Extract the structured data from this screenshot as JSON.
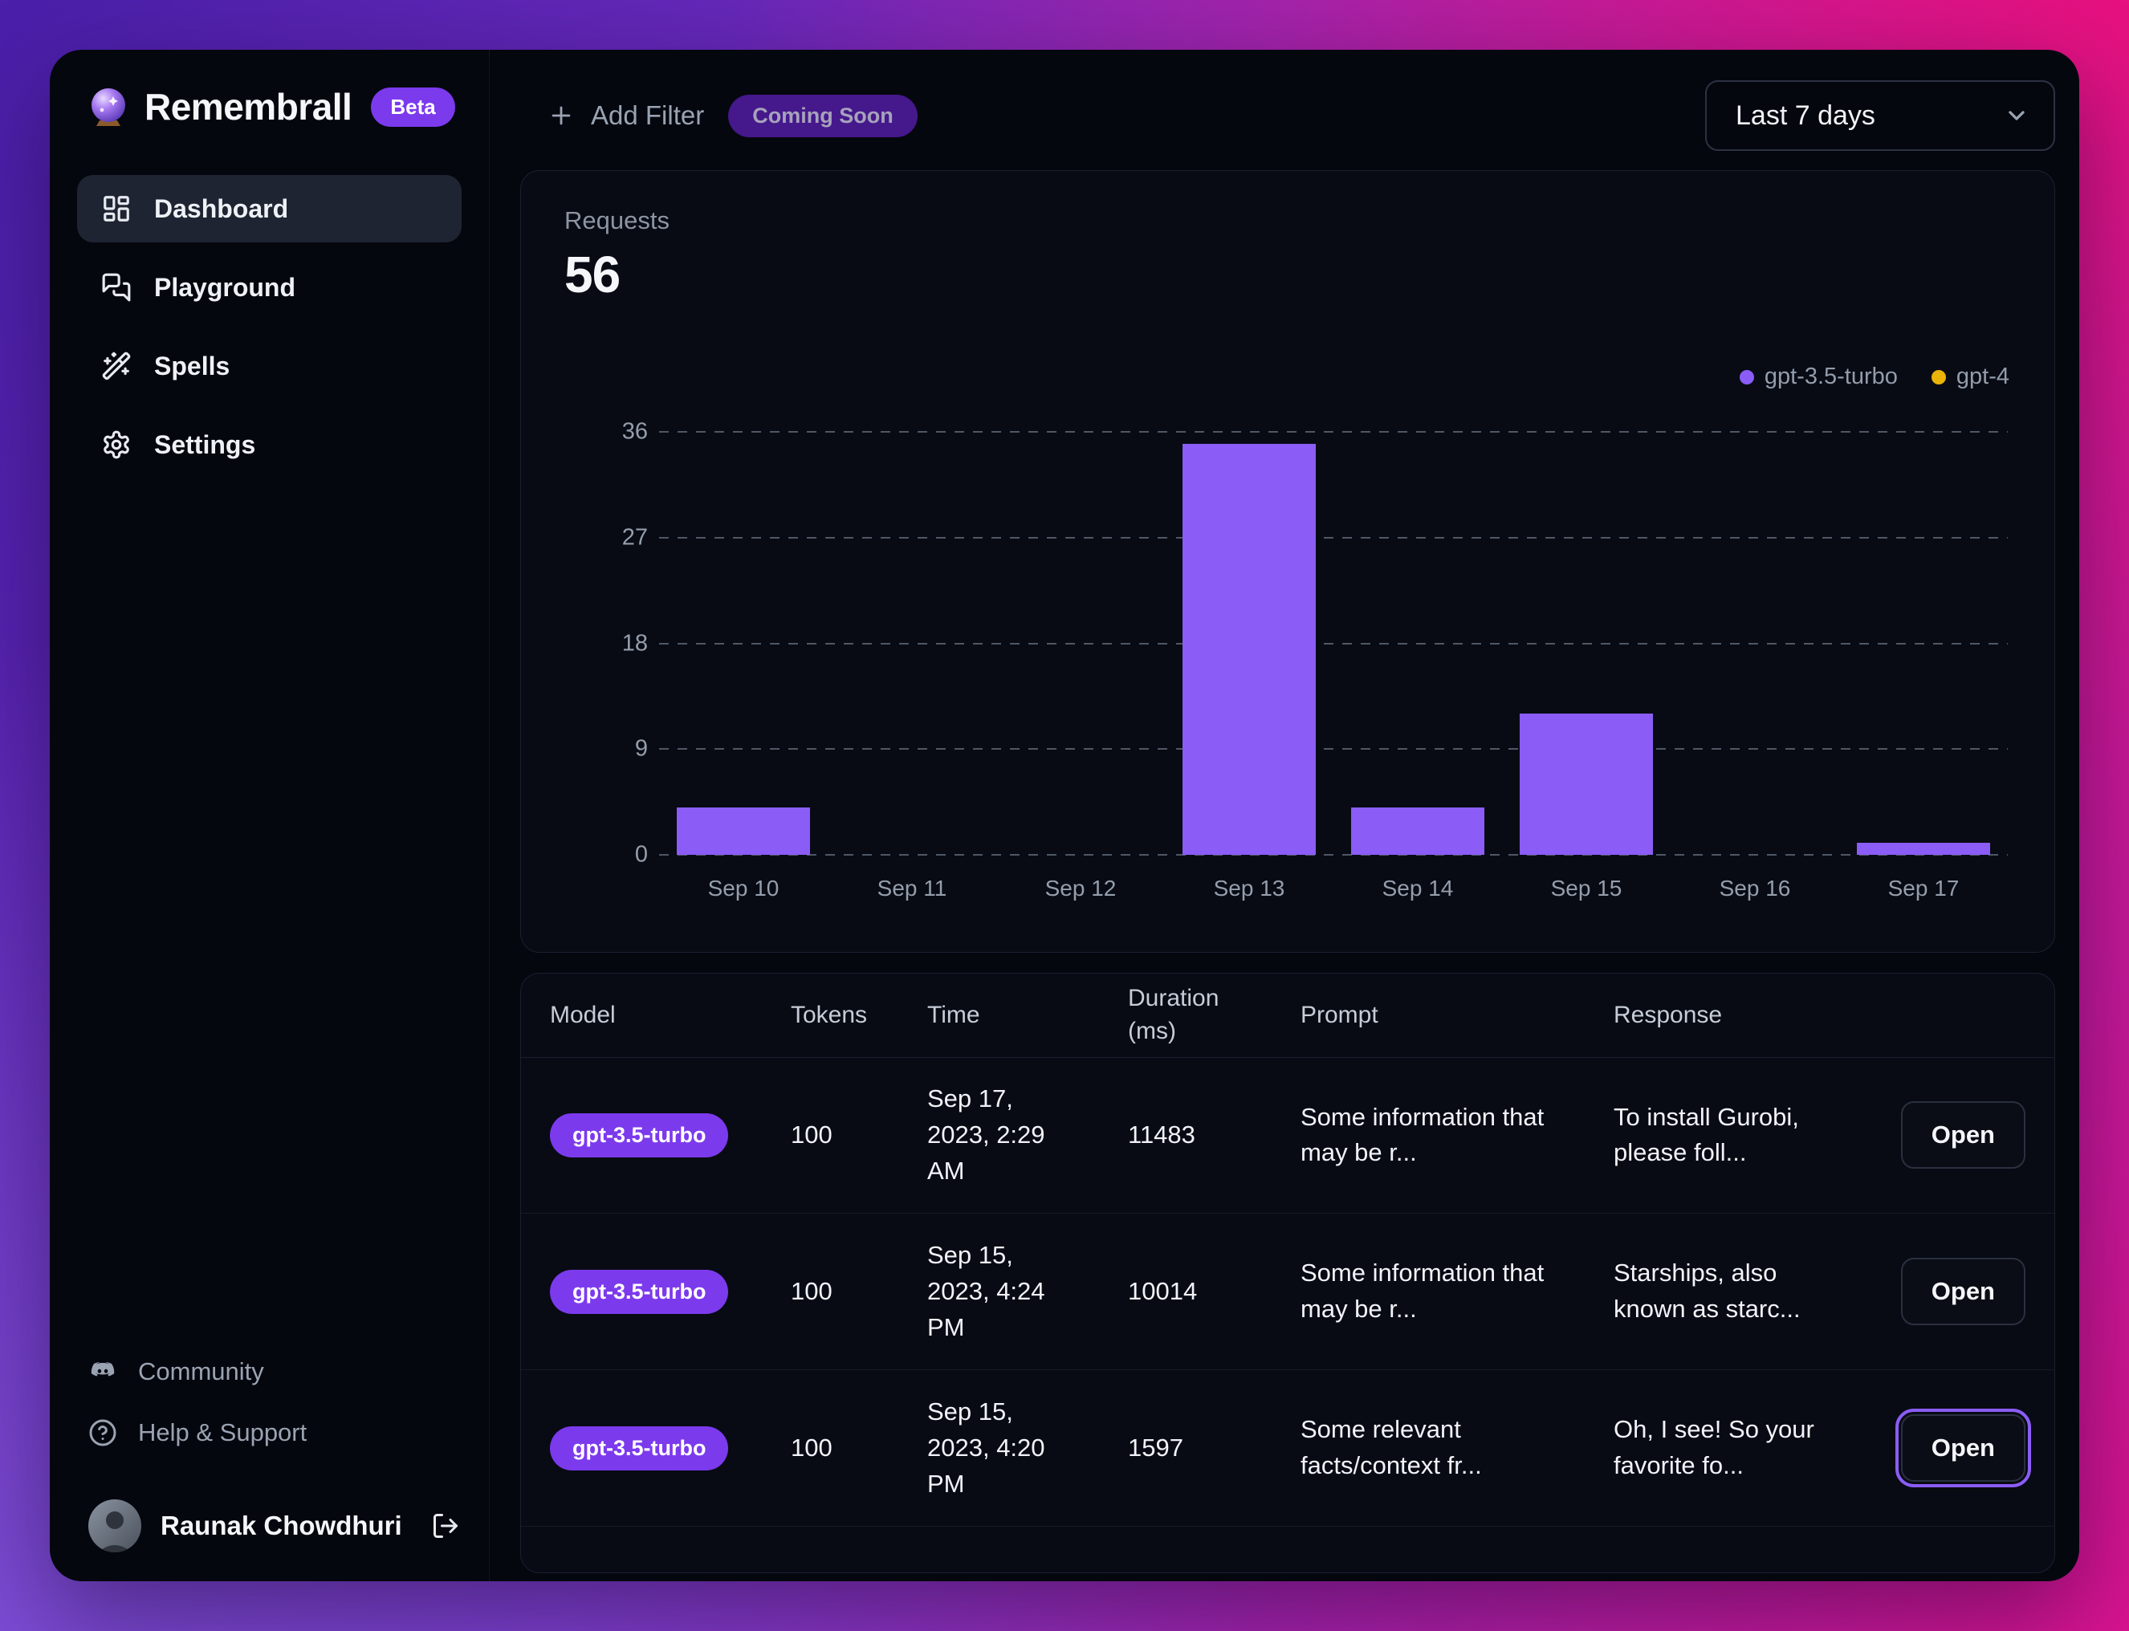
{
  "app": {
    "name": "Remembrall",
    "badge": "Beta"
  },
  "sidebar": {
    "items": [
      {
        "label": "Dashboard",
        "active": true
      },
      {
        "label": "Playground",
        "active": false
      },
      {
        "label": "Spells",
        "active": false
      },
      {
        "label": "Settings",
        "active": false
      }
    ],
    "footer_items": [
      {
        "label": "Community"
      },
      {
        "label": "Help & Support"
      }
    ],
    "user": {
      "name": "Raunak Chowdhuri"
    }
  },
  "header": {
    "add_filter_label": "Add Filter",
    "coming_soon_badge": "Coming Soon",
    "date_range_value": "Last 7 days"
  },
  "stats": {
    "label": "Requests",
    "value": "56"
  },
  "colors": {
    "accent": "#7c3aed",
    "bar_purple": "#8b5cf6",
    "gpt4_amber": "#eab308",
    "gradient_purple": "#4a1fa9",
    "gradient_magenta": "#e8117f"
  },
  "chart_data": {
    "type": "bar",
    "title": "Requests",
    "total": 56,
    "categories": [
      "Sep 10",
      "Sep 11",
      "Sep 12",
      "Sep 13",
      "Sep 14",
      "Sep 15",
      "Sep 16",
      "Sep 17"
    ],
    "series": [
      {
        "name": "gpt-3.5-turbo",
        "color": "#8b5cf6",
        "values": [
          4,
          0,
          0,
          35,
          4,
          12,
          0,
          1
        ]
      },
      {
        "name": "gpt-4",
        "color": "#eab308",
        "values": [
          0,
          0,
          0,
          0,
          0,
          0,
          0,
          0
        ]
      }
    ],
    "ylim": [
      0,
      36
    ],
    "yticks": [
      0,
      9,
      18,
      27,
      36
    ],
    "grid": true,
    "legend_position": "top-right"
  },
  "table": {
    "columns": [
      "Model",
      "Tokens",
      "Time",
      "Duration (ms)",
      "Prompt",
      "Response"
    ],
    "rows": [
      {
        "model": "gpt-3.5-turbo",
        "tokens": "100",
        "time": "Sep 17, 2023, 2:29 AM",
        "duration": "11483",
        "prompt": "Some information that may be r...",
        "response": "To install Gurobi, please foll...",
        "action": "Open",
        "open_focused": false
      },
      {
        "model": "gpt-3.5-turbo",
        "tokens": "100",
        "time": "Sep 15, 2023, 4:24 PM",
        "duration": "10014",
        "prompt": "Some information that may be r...",
        "response": "Starships, also known as starc...",
        "action": "Open",
        "open_focused": false
      },
      {
        "model": "gpt-3.5-turbo",
        "tokens": "100",
        "time": "Sep 15, 2023, 4:20 PM",
        "duration": "1597",
        "prompt": "Some relevant facts/⁠context fr...",
        "response": "Oh, I see! So your favorite fo...",
        "action": "Open",
        "open_focused": true
      }
    ]
  }
}
